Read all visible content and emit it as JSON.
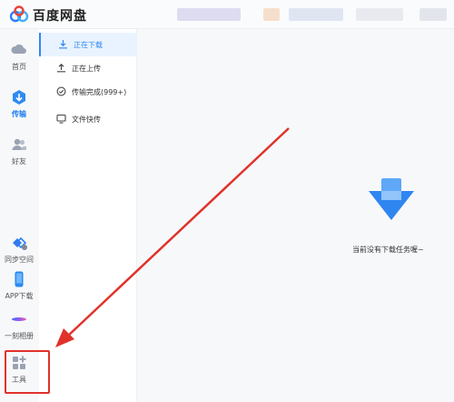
{
  "app": {
    "title": "百度网盘"
  },
  "rail": {
    "items": [
      {
        "label": "首页"
      },
      {
        "label": "传输"
      },
      {
        "label": "好友"
      },
      {
        "label": "同步空间"
      },
      {
        "label": "APP下载"
      },
      {
        "label": "一刻相册"
      },
      {
        "label": "工具"
      }
    ]
  },
  "transfer_nav": {
    "items": [
      {
        "label": "正在下载"
      },
      {
        "label": "正在上传"
      },
      {
        "label": "传输完成(999+)"
      },
      {
        "label": "文件快传"
      }
    ]
  },
  "main": {
    "empty_message": "当前没有下载任务喔~"
  },
  "colors": {
    "accent": "#2e88f0",
    "annotation": "#e0322b"
  }
}
